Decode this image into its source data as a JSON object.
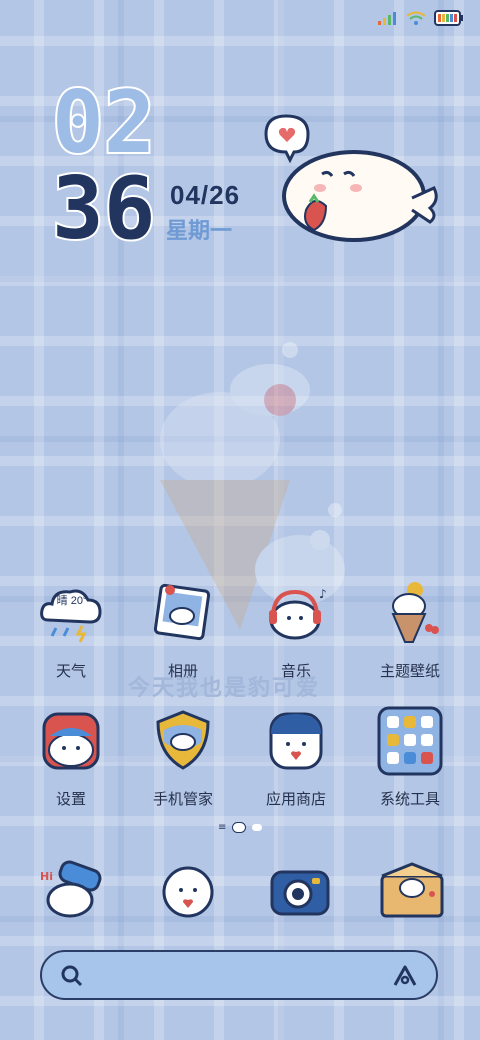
{
  "clock": {
    "hour": "02",
    "minute": "36",
    "date": "04/26",
    "weekday": "星期一"
  },
  "weather_widget": {
    "text": "晴 20°"
  },
  "wallpaper_text": "今天我也是豹可爱",
  "apps": [
    {
      "label": "天气",
      "icon": "weather-icon"
    },
    {
      "label": "相册",
      "icon": "gallery-icon"
    },
    {
      "label": "音乐",
      "icon": "music-icon"
    },
    {
      "label": "主题壁纸",
      "icon": "themes-icon"
    },
    {
      "label": "设置",
      "icon": "settings-icon"
    },
    {
      "label": "手机管家",
      "icon": "security-icon"
    },
    {
      "label": "应用商店",
      "icon": "app-store-icon"
    },
    {
      "label": "系统工具",
      "icon": "system-tools-folder-icon"
    }
  ],
  "page_indicator": {
    "pages": 3,
    "active": 2
  },
  "dock": [
    {
      "icon": "phone-icon"
    },
    {
      "icon": "messages-icon"
    },
    {
      "icon": "camera-icon"
    },
    {
      "icon": "mail-icon"
    }
  ],
  "colors": {
    "navy": "#22355f",
    "light_blue": "#6f9ad4",
    "background": "#b3c6e6",
    "accent_red": "#d9534f"
  }
}
